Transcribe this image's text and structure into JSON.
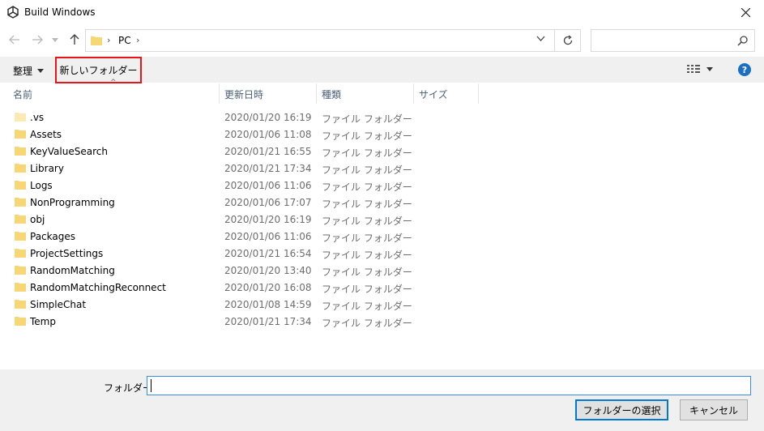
{
  "window": {
    "title": "Build Windows"
  },
  "address": {
    "crumb_sep": "›",
    "location": "PC",
    "trailing_sep": "›"
  },
  "search": {
    "value": ""
  },
  "toolbar": {
    "organize_label": "整理",
    "new_folder_label": "新しいフォルダー"
  },
  "columns": {
    "name": "名前",
    "date": "更新日時",
    "type": "種類",
    "size": "サイズ"
  },
  "files": [
    {
      "name": ".vs",
      "date": "2020/01/20 16:19",
      "type": "ファイル フォルダー",
      "hidden": true
    },
    {
      "name": "Assets",
      "date": "2020/01/06 11:08",
      "type": "ファイル フォルダー"
    },
    {
      "name": "KeyValueSearch",
      "date": "2020/01/21 16:55",
      "type": "ファイル フォルダー"
    },
    {
      "name": "Library",
      "date": "2020/01/21 17:34",
      "type": "ファイル フォルダー"
    },
    {
      "name": "Logs",
      "date": "2020/01/06 11:06",
      "type": "ファイル フォルダー"
    },
    {
      "name": "NonProgramming",
      "date": "2020/01/06 17:07",
      "type": "ファイル フォルダー"
    },
    {
      "name": "obj",
      "date": "2020/01/20 16:19",
      "type": "ファイル フォルダー"
    },
    {
      "name": "Packages",
      "date": "2020/01/06 11:06",
      "type": "ファイル フォルダー"
    },
    {
      "name": "ProjectSettings",
      "date": "2020/01/21 16:54",
      "type": "ファイル フォルダー"
    },
    {
      "name": "RandomMatching",
      "date": "2020/01/20 13:40",
      "type": "ファイル フォルダー"
    },
    {
      "name": "RandomMatchingReconnect",
      "date": "2020/01/20 16:08",
      "type": "ファイル フォルダー"
    },
    {
      "name": "SimpleChat",
      "date": "2020/01/08 14:59",
      "type": "ファイル フォルダー"
    },
    {
      "name": "Temp",
      "date": "2020/01/21 17:34",
      "type": "ファイル フォルダー"
    }
  ],
  "footer": {
    "folder_label": "フォルダー:",
    "folder_value": "",
    "select_label": "フォルダーの選択",
    "cancel_label": "キャンセル"
  },
  "colors": {
    "folder": "#f7d675",
    "folder_hidden": "#fbeab4",
    "accent": "#0078d7",
    "highlight": "#e8141a"
  }
}
